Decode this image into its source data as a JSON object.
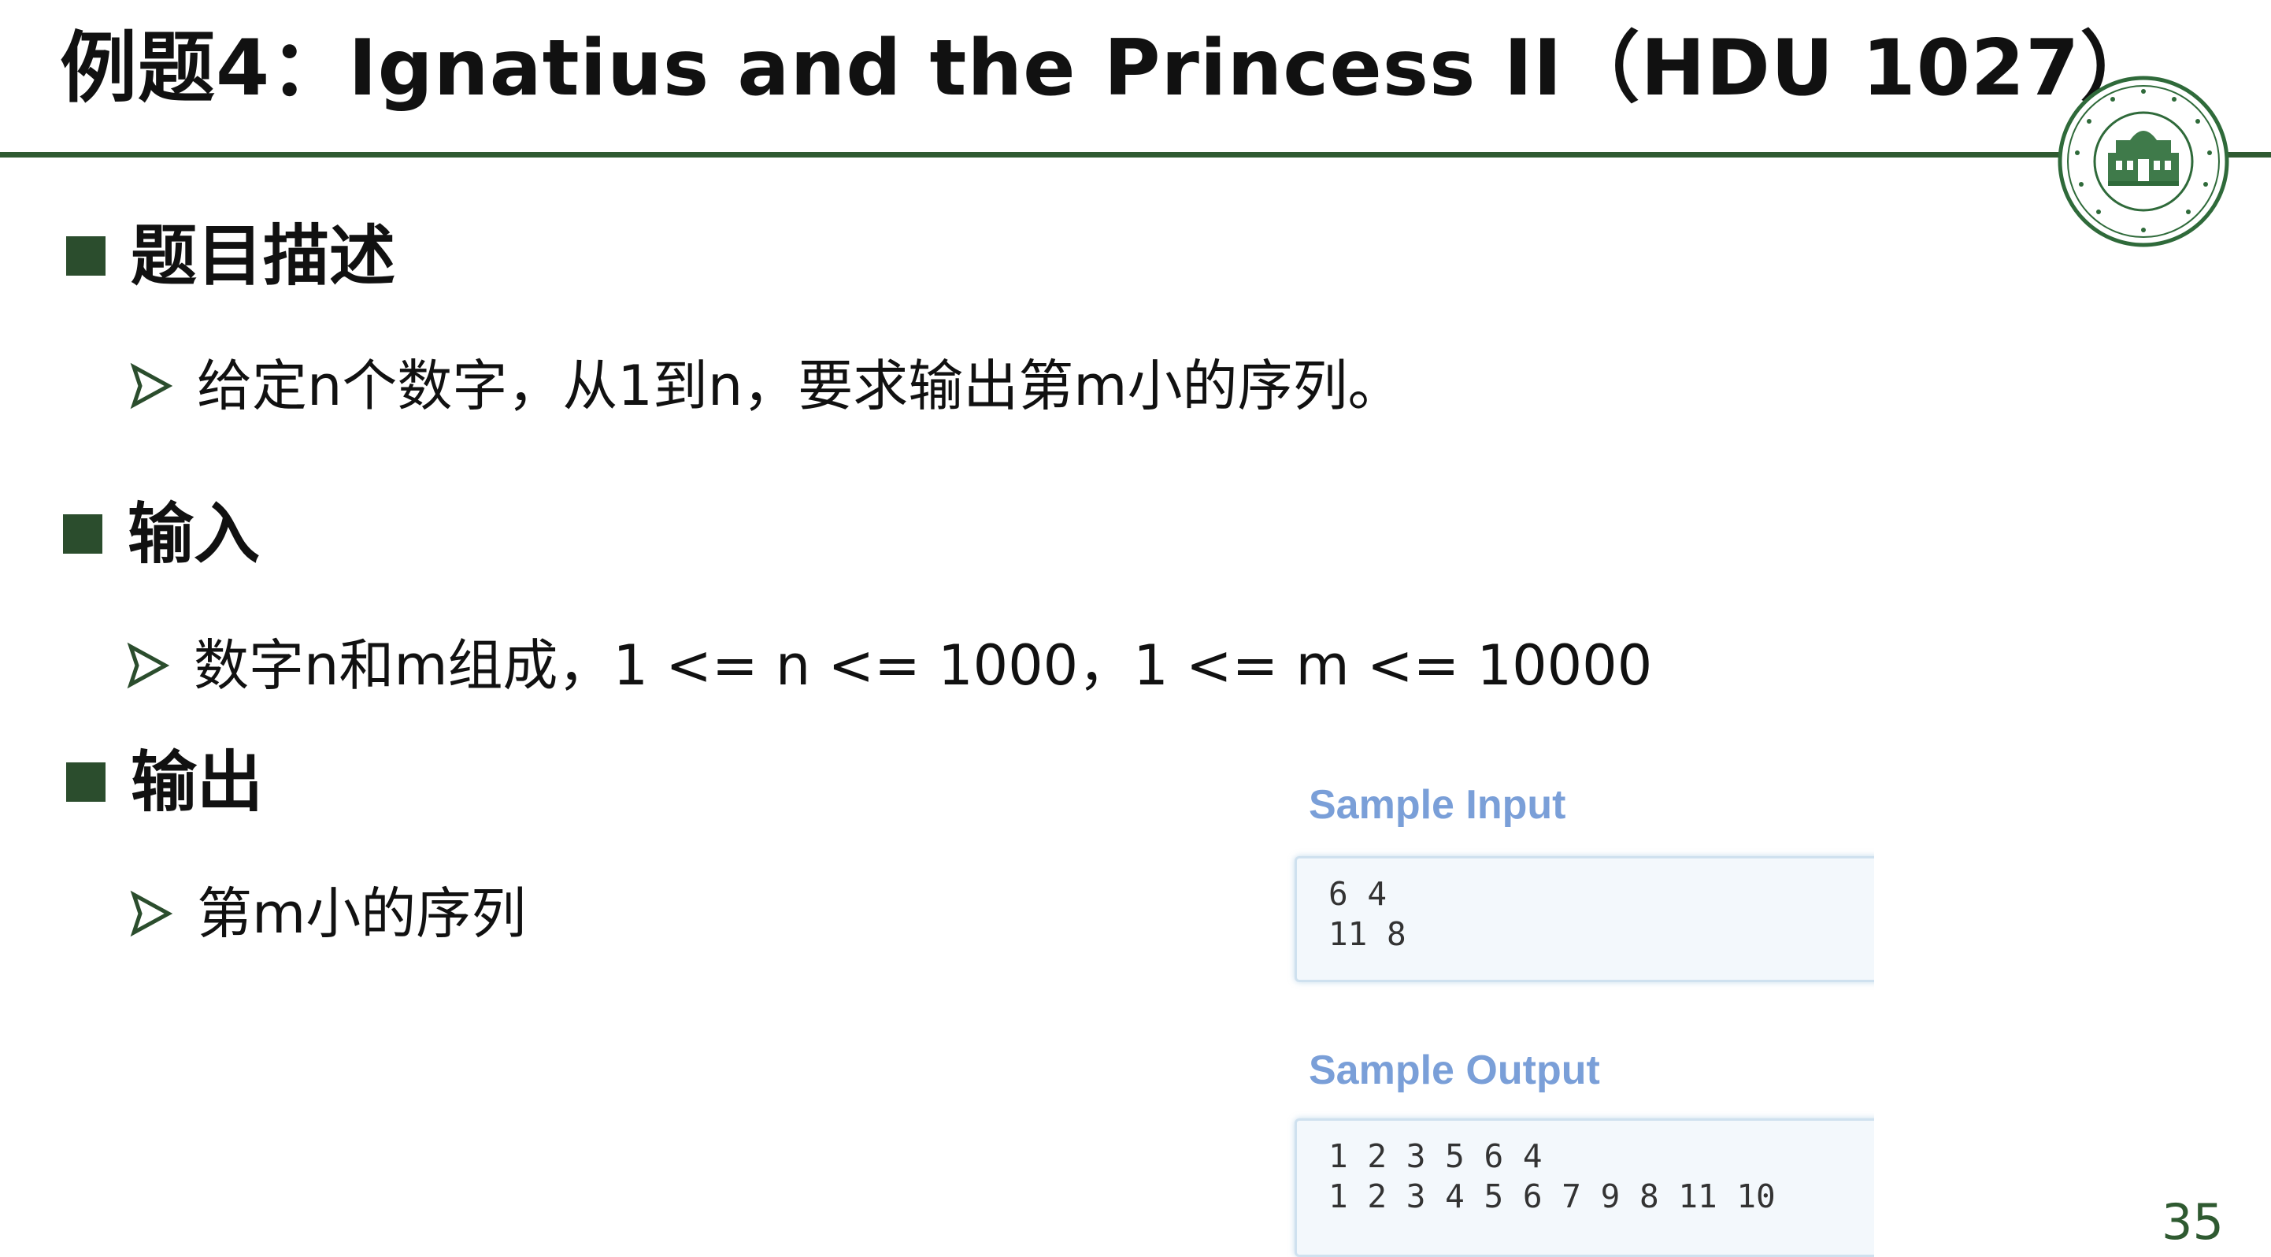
{
  "slide": {
    "title": "例题4：Ignatius and the Princess II（HDU 1027）",
    "page_number": "35",
    "accent_color": "#2f5a31",
    "bullet_color": "#2b4d2d"
  },
  "sections": [
    {
      "heading": "题目描述",
      "bullet": "给定n个数字，从1到n，要求输出第m小的序列。"
    },
    {
      "heading": "输入",
      "bullet": "数字n和m组成，1 <= n <= 1000，1 <= m <= 10000"
    },
    {
      "heading": "输出",
      "bullet": "第m小的序列"
    }
  ],
  "sample": {
    "input_label": "Sample Input",
    "input_lines": [
      "6 4",
      "11 8"
    ],
    "output_label": "Sample Output",
    "output_lines": [
      "1 2 3 5 6 4",
      "1 2 3 4 5 6 7 9 8 11 10"
    ],
    "label_color": "#7a9fd8"
  },
  "logo": {
    "icon": "school-seal-icon"
  }
}
